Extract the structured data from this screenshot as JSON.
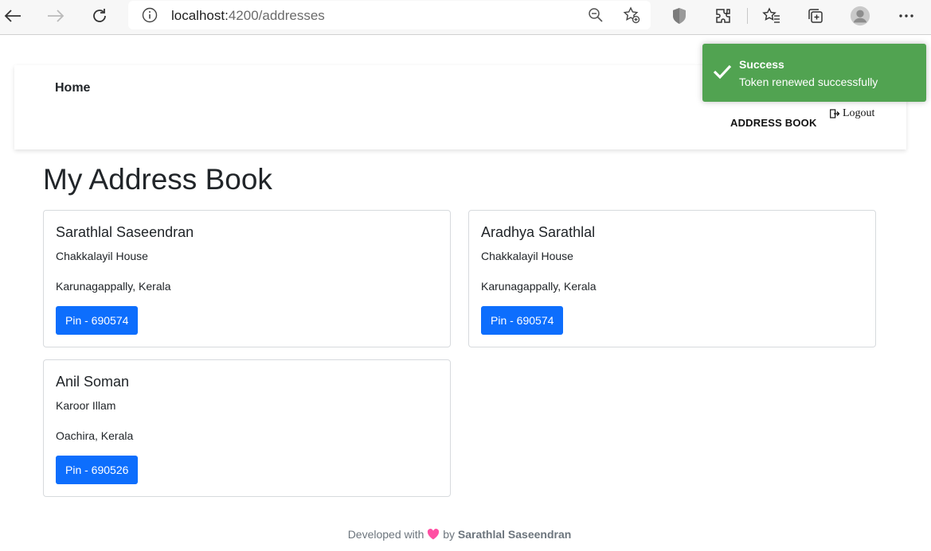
{
  "browser": {
    "url_host": "localhost:",
    "url_path": "4200/addresses"
  },
  "navbar": {
    "home_label": "Home",
    "address_book_label": "ADDRESS BOOK",
    "logout_label": "Logout"
  },
  "page": {
    "title": "My Address Book"
  },
  "addresses": [
    {
      "name": "Sarathlal Saseendran",
      "line1": "Chakkalayil House",
      "line2": "Karunagappally, Kerala",
      "pin": "Pin - 690574"
    },
    {
      "name": "Aradhya Sarathlal",
      "line1": "Chakkalayil House",
      "line2": "Karunagappally, Kerala",
      "pin": "Pin - 690574"
    },
    {
      "name": "Anil Soman",
      "line1": "Karoor Illam",
      "line2": "Oachira, Kerala",
      "pin": "Pin - 690526"
    }
  ],
  "footer": {
    "prefix": "Developed with",
    "by": "by",
    "author": "Sarathlal Saseendran"
  },
  "toast": {
    "title": "Success",
    "message": "Token renewed successfully"
  },
  "colors": {
    "primary_button": "#0d6efd",
    "toast_success": "#51a351",
    "heart": "#ff4fa3"
  }
}
